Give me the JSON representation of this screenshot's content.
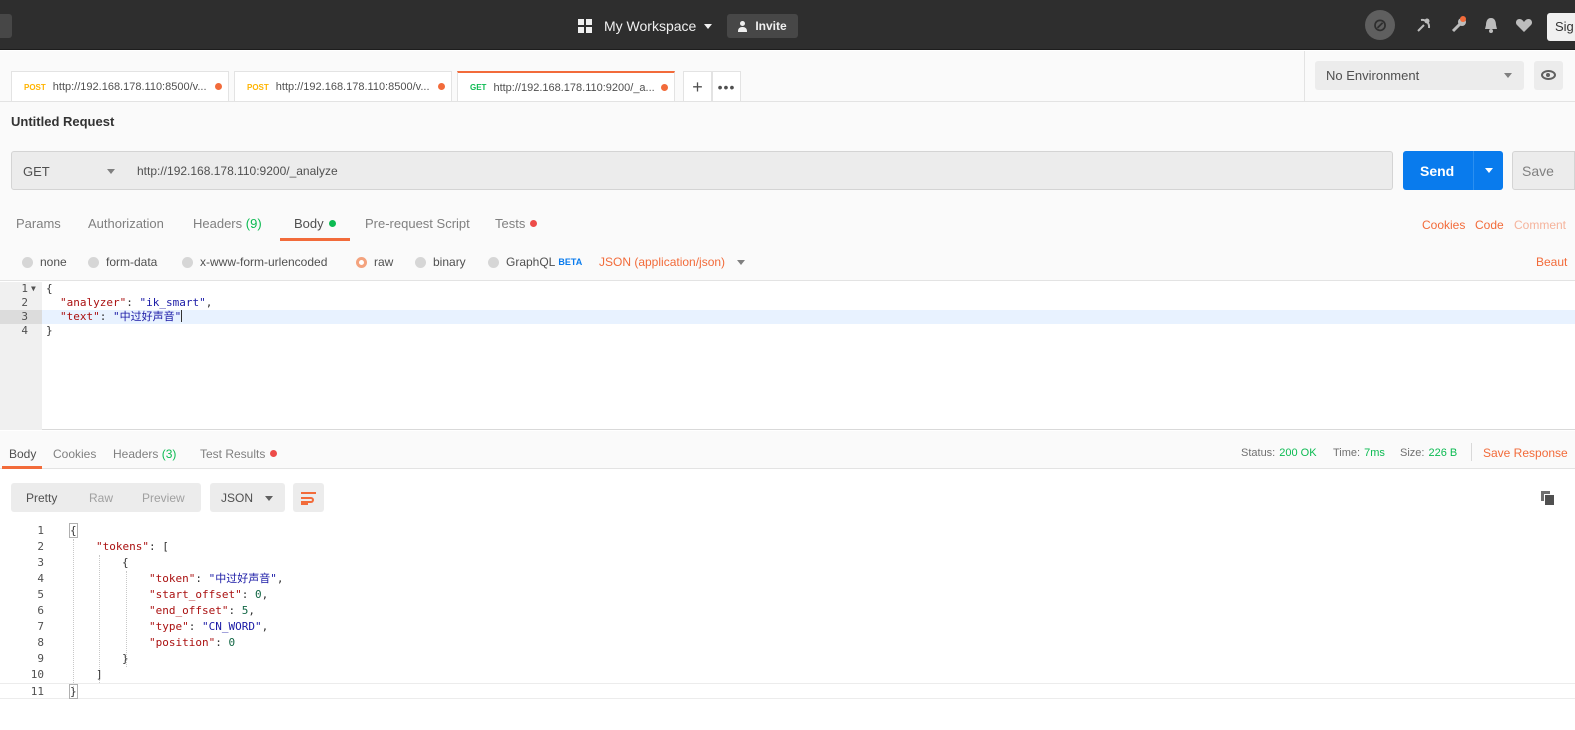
{
  "topbar": {
    "workspace_label": "My Workspace",
    "invite_label": "Invite",
    "sign_label": "Sig"
  },
  "tabs": [
    {
      "method": "POST",
      "url": "http://192.168.178.110:8500/v..."
    },
    {
      "method": "POST",
      "url": "http://192.168.178.110:8500/v..."
    },
    {
      "method": "GET",
      "url": "http://192.168.178.110:9200/_a..."
    }
  ],
  "environment": {
    "selected": "No Environment"
  },
  "request": {
    "name": "Untitled Request",
    "method": "GET",
    "url": "http://192.168.178.110:9200/_analyze",
    "send_label": "Send",
    "save_label": "Save"
  },
  "request_tabs": {
    "params": "Params",
    "authorization": "Authorization",
    "headers": "Headers",
    "headers_count": "(9)",
    "body": "Body",
    "prerequest": "Pre-request Script",
    "tests": "Tests",
    "cookies": "Cookies",
    "code": "Code",
    "comments": "Comment"
  },
  "body_types": {
    "none": "none",
    "form_data": "form-data",
    "urlencoded": "x-www-form-urlencoded",
    "raw": "raw",
    "binary": "binary",
    "graphql": "GraphQL",
    "beta": "BETA",
    "content_type": "JSON (application/json)",
    "beautify": "Beaut"
  },
  "editor": {
    "line_numbers": [
      "1",
      "2",
      "3",
      "4"
    ],
    "l1": "{",
    "l2_key": "\"analyzer\"",
    "l2_val": "\"ik_smart\"",
    "l3_key": "\"text\"",
    "l3_val": "\"中过好声音\"",
    "l4": "}"
  },
  "response_tabs": {
    "body": "Body",
    "cookies": "Cookies",
    "headers": "Headers",
    "headers_count": "(3)",
    "test_results": "Test Results",
    "status_label": "Status:",
    "status_value": "200 OK",
    "time_label": "Time:",
    "time_value": "7ms",
    "size_label": "Size:",
    "size_value": "226 B",
    "save_response": "Save Response"
  },
  "response_toolbar": {
    "pretty": "Pretty",
    "raw": "Raw",
    "preview": "Preview",
    "format": "JSON"
  },
  "response": {
    "line_numbers": [
      "1",
      "2",
      "3",
      "4",
      "5",
      "6",
      "7",
      "8",
      "9",
      "10",
      "11"
    ],
    "tokens_key": "\"tokens\"",
    "token_key": "\"token\"",
    "token_val": "\"中过好声音\"",
    "start_key": "\"start_offset\"",
    "start_val": "0",
    "end_key": "\"end_offset\"",
    "end_val": "5",
    "type_key": "\"type\"",
    "type_val": "\"CN_WORD\"",
    "position_key": "\"position\"",
    "position_val": "0"
  },
  "colors": {
    "accent": "#f26b3a",
    "send": "#097bed",
    "success": "#0cbb52",
    "topbar": "#2e2e2e"
  }
}
